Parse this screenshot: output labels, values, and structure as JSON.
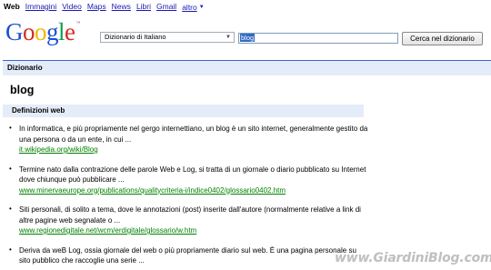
{
  "topnav": {
    "items": [
      "Web",
      "Immagini",
      "Video",
      "Maps",
      "News",
      "Libri",
      "Gmail"
    ],
    "more_label": "altro",
    "more_caret": "▼"
  },
  "logo": {
    "letters": [
      "G",
      "o",
      "o",
      "g",
      "l",
      "e"
    ],
    "colors": [
      "#1a4fd6",
      "#d52b1e",
      "#f4b400",
      "#1a4fd6",
      "#109d59",
      "#d52b1e"
    ],
    "tm": "™"
  },
  "search": {
    "dictionary_select": "Dizionario di Italiano",
    "query": "blog",
    "button_label": "Cerca nel dizionario"
  },
  "section": {
    "title": "Dizionario"
  },
  "entry": {
    "term": "blog",
    "web_definitions_header": "Definizioni web",
    "definitions": [
      {
        "text": "In informatica, e più propriamente nel gergo internettiano, un blog è un sito internet, generalmente gestito da una persona o da un ente, in cui ...",
        "url": "it.wikipedia.org/wiki/Blog"
      },
      {
        "text": "Termine nato dalla contrazione delle parole Web e Log, si tratta di un giornale o diario pubblicato su Internet dove chiunque può pubblicare ...",
        "url": "www.minervaeurope.org/publications/qualitycriteria-i/indice0402/glossario0402.htm"
      },
      {
        "text": "Siti personali, di solito a tema, dove le annotazioni (post) inserite dall'autore (normalmente relative a link di altre pagine web segnalate o ...",
        "url": "www.regionedigitale.net/wcm/erdigitale/glossario/w.htm"
      },
      {
        "text": "Deriva da weB Log, ossia giornale del web o più propriamente diario sul web. È una pagina personale su sito pubblico che raccoglie una serie ...",
        "url": ""
      }
    ]
  },
  "watermark": "www.GiardiniBlog.com"
}
